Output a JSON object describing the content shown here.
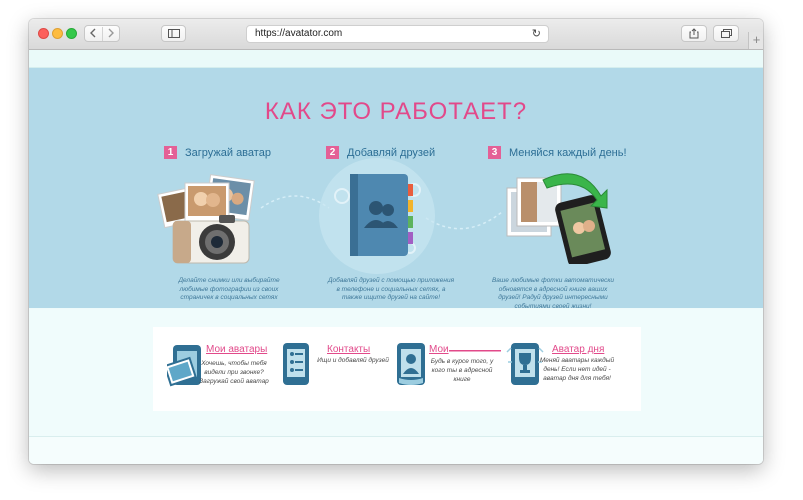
{
  "browser": {
    "url": "https://avatator.com",
    "new_tab_glyph": "+"
  },
  "hero": {
    "title": "КАК ЭТО РАБОТАЕТ?",
    "steps": [
      {
        "num": "1",
        "label": "Загружай аватар",
        "desc": "Делайте снимки или выбирайте любимые фотографии из своих страничек в социальных сетях"
      },
      {
        "num": "2",
        "label": "Добавляй друзей",
        "desc": "Добавляй друзей с помощью приложения в телефоне и социальных сетях, а также ищите друзей на сайте!"
      },
      {
        "num": "3",
        "label": "Меняйся каждый день!",
        "desc": "Ваше любимые фотки автоматически обновятся в адресной книге ваших друзей! Радуй друзей интересными событиями своей жизни!"
      }
    ]
  },
  "features": [
    {
      "title": "Мои аватары",
      "desc": "Хочешь, чтобы тебя видели при звонке? Загружай свой аватар"
    },
    {
      "title": "Контакты",
      "desc": "Ищи и добавляй друзей"
    },
    {
      "title": "Мои",
      "desc": "Будь в курсе того, у кого ты в адресной книге"
    },
    {
      "title": "Аватар дня",
      "desc": "Меняй аватары каждый день! Если нет идей - аватар дня для тебя!"
    }
  ],
  "colors": {
    "accent": "#e2498a",
    "hero_bg": "#b2d9e8",
    "text_blue": "#2c6e95",
    "icon_blue": "#2f6f93"
  }
}
